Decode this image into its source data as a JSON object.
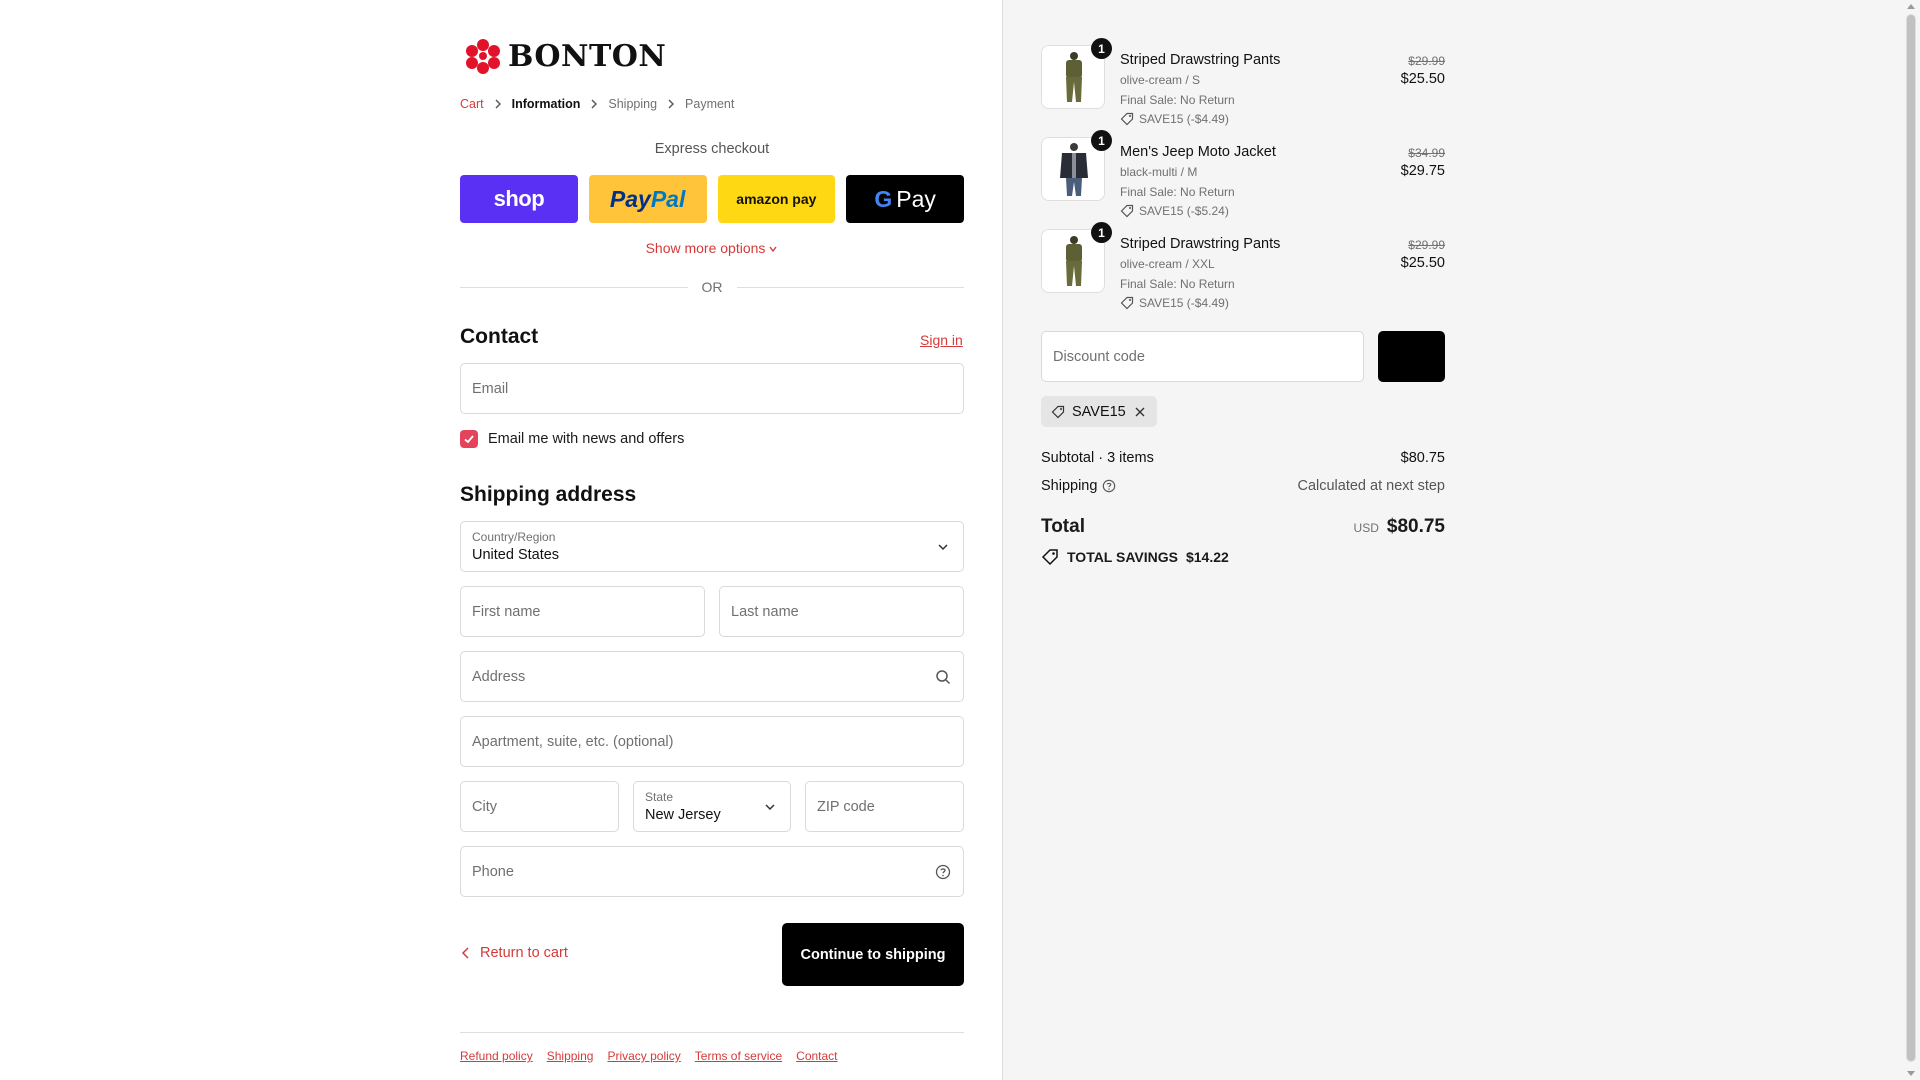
{
  "brand": {
    "logo_text": "BONTON",
    "accent": "#d53a3a"
  },
  "breadcrumb": [
    {
      "label": "Cart",
      "state": "link"
    },
    {
      "label": "Information",
      "state": "active"
    },
    {
      "label": "Shipping",
      "state": "inactive"
    },
    {
      "label": "Payment",
      "state": "inactive"
    }
  ],
  "express": {
    "title": "Express checkout",
    "buttons": {
      "shop": "shop",
      "paypal_a": "Pay",
      "paypal_b": "Pal",
      "amazon": "amazon pay",
      "gpay_g": "G",
      "gpay": "Pay"
    },
    "more_options": "Show more options",
    "or": "OR"
  },
  "contact": {
    "title": "Contact",
    "sign_in": "Sign in",
    "email_placeholder": "Email",
    "newsletter_label": "Email me with news and offers",
    "newsletter_checked": true
  },
  "shipping": {
    "title": "Shipping address",
    "country_label": "Country/Region",
    "country_value": "United States",
    "first_name": "First name",
    "last_name": "Last name",
    "address": "Address",
    "apartment": "Apartment, suite, etc. (optional)",
    "city": "City",
    "state_label": "State",
    "state_value": "New Jersey",
    "zip": "ZIP code",
    "phone": "Phone"
  },
  "actions": {
    "return": "Return to cart",
    "continue": "Continue to shipping"
  },
  "footer": [
    "Refund policy",
    "Shipping",
    "Privacy policy",
    "Terms of service",
    "Contact"
  ],
  "cart": {
    "items": [
      {
        "qty": "1",
        "name": "Striped Drawstring Pants",
        "variant": "olive-cream / S",
        "note": "Final Sale: No Return",
        "discount": "SAVE15 (-$4.49)",
        "old_price": "$29.99",
        "price": "$25.50"
      },
      {
        "qty": "1",
        "name": "Men's Jeep Moto Jacket",
        "variant": "black-multi / M",
        "note": "Final Sale: No Return",
        "discount": "SAVE15 (-$5.24)",
        "old_price": "$34.99",
        "price": "$29.75"
      },
      {
        "qty": "1",
        "name": "Striped Drawstring Pants",
        "variant": "olive-cream / XXL",
        "note": "Final Sale: No Return",
        "discount": "SAVE15 (-$4.49)",
        "old_price": "$29.99",
        "price": "$25.50"
      }
    ],
    "discount_placeholder": "Discount code",
    "applied_code": "SAVE15",
    "subtotal_label": "Subtotal · 3 items",
    "subtotal_value": "$80.75",
    "shipping_label": "Shipping",
    "shipping_value": "Calculated at next step",
    "total_label": "Total",
    "currency": "USD",
    "total_value": "$80.75",
    "savings_label": "TOTAL SAVINGS",
    "savings_value": "$14.22"
  }
}
